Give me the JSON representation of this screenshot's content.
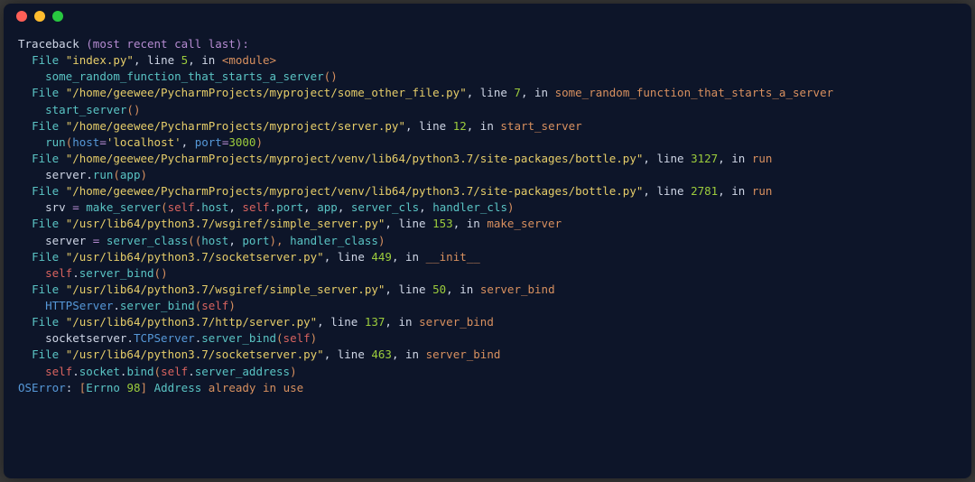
{
  "traceback": {
    "header_prefix": "Traceback ",
    "header_paren": "(most recent call last):",
    "frames": [
      {
        "file_label": "File",
        "file_path": "\"index.py\"",
        "line_label": ", line ",
        "line_num": "5",
        "in_label": ", in ",
        "func_name": "<module>",
        "code": {
          "parts": [
            "some_random_function_that_starts_a_server",
            "(",
            ")"
          ]
        }
      },
      {
        "file_label": "File",
        "file_path": "\"/home/geewee/PycharmProjects/myproject/some_other_file.py\"",
        "line_label": ", line ",
        "line_num": "7",
        "in_label": ", in ",
        "func_name": "some_random_function_that_starts_a_server",
        "code": {
          "parts": [
            "start_server",
            "(",
            ")"
          ]
        }
      },
      {
        "file_label": "File",
        "file_path": "\"/home/geewee/PycharmProjects/myproject/server.py\"",
        "line_label": ", line ",
        "line_num": "12",
        "in_label": ", in ",
        "func_name": "start_server",
        "code": {
          "parts": [
            "run",
            "(",
            "host",
            "=",
            "'localhost'",
            ", ",
            "port",
            "=",
            "3000",
            ")"
          ]
        }
      },
      {
        "file_label": "File",
        "file_path": "\"/home/geewee/PycharmProjects/myproject/venv/lib64/python3.7/site-packages/bottle.py\"",
        "line_label": ", line ",
        "line_num": "3127",
        "in_label": ", in ",
        "func_name": "run",
        "code": {
          "parts": [
            "server",
            ".",
            "run",
            "(",
            "app",
            ")"
          ]
        }
      },
      {
        "file_label": "File",
        "file_path": "\"/home/geewee/PycharmProjects/myproject/venv/lib64/python3.7/site-packages/bottle.py\"",
        "line_label": ", line ",
        "line_num": "2781",
        "in_label": ", in ",
        "func_name": "run",
        "code": {
          "parts": [
            "srv ",
            "= ",
            "make_server",
            "(",
            "self",
            ".",
            "host",
            ", ",
            "self",
            ".",
            "port",
            ", ",
            "app",
            ", ",
            "server_cls",
            ", ",
            "handler_cls",
            ")"
          ]
        }
      },
      {
        "file_label": "File",
        "file_path": "\"/usr/lib64/python3.7/wsgiref/simple_server.py\"",
        "line_label": ", line ",
        "line_num": "153",
        "in_label": ", in ",
        "func_name": "make_server",
        "code": {
          "parts": [
            "server ",
            "= ",
            "server_class",
            "((",
            "host",
            ", ",
            "port",
            "), ",
            "handler_class",
            ")"
          ]
        }
      },
      {
        "file_label": "File",
        "file_path": "\"/usr/lib64/python3.7/socketserver.py\"",
        "line_label": ", line ",
        "line_num": "449",
        "in_label": ", in ",
        "func_name": "__init__",
        "code": {
          "parts": [
            "self",
            ".",
            "server_bind",
            "(",
            ")"
          ]
        }
      },
      {
        "file_label": "File",
        "file_path": "\"/usr/lib64/python3.7/wsgiref/simple_server.py\"",
        "line_label": ", line ",
        "line_num": "50",
        "in_label": ", in ",
        "func_name": "server_bind",
        "code": {
          "parts": [
            "HTTPServer",
            ".",
            "server_bind",
            "(",
            "self",
            ")"
          ]
        }
      },
      {
        "file_label": "File",
        "file_path": "\"/usr/lib64/python3.7/http/server.py\"",
        "line_label": ", line ",
        "line_num": "137",
        "in_label": ", in ",
        "func_name": "server_bind",
        "code": {
          "parts": [
            "socketserver",
            ".",
            "TCPServer",
            ".",
            "server_bind",
            "(",
            "self",
            ")"
          ]
        }
      },
      {
        "file_label": "File",
        "file_path": "\"/usr/lib64/python3.7/socketserver.py\"",
        "line_label": ", line ",
        "line_num": "463",
        "in_label": ", in ",
        "func_name": "server_bind",
        "code": {
          "parts": [
            "self",
            ".",
            "socket",
            ".",
            "bind",
            "(",
            "self",
            ".",
            "server_address",
            ")"
          ]
        }
      }
    ],
    "error": {
      "type": "OSError",
      "colon": ": ",
      "bracket_open": "[",
      "errno_label": "Errno ",
      "errno_num": "98",
      "bracket_close": "] ",
      "msg_word1": "Address ",
      "msg_word2": "already in use"
    }
  }
}
